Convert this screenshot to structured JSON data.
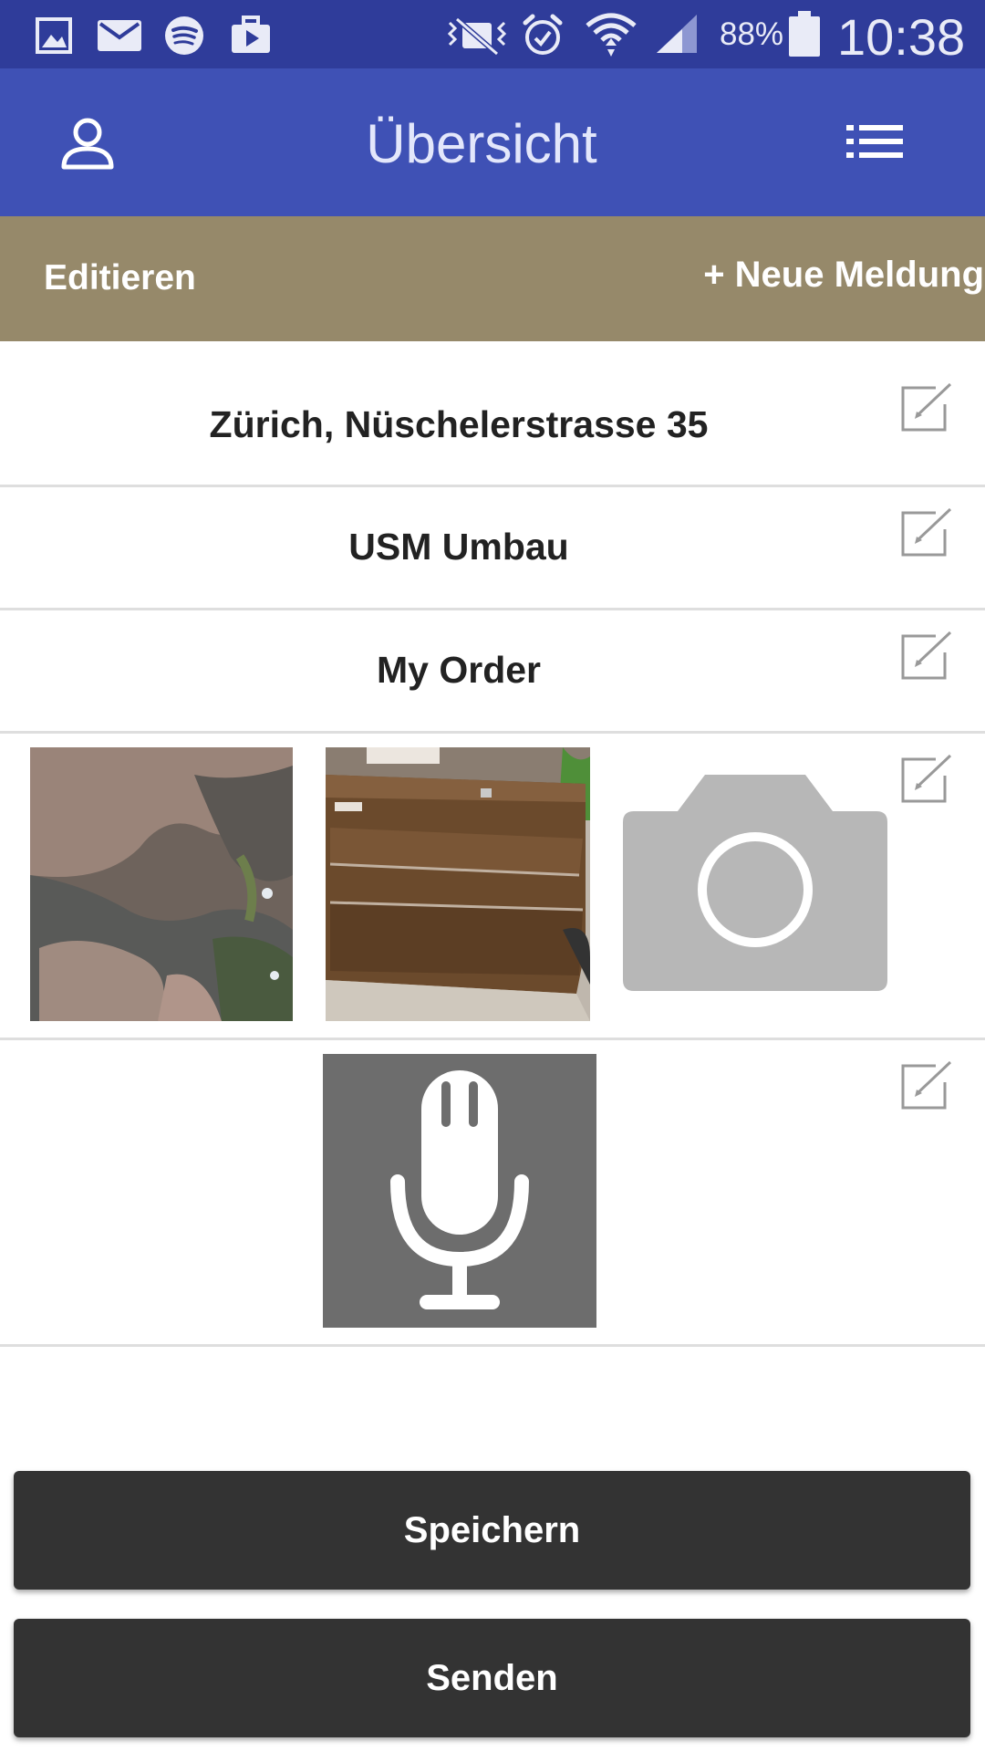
{
  "status_bar": {
    "battery": "88%",
    "time": "10:38",
    "icons": [
      "gallery-icon",
      "mail-icon",
      "spotify-icon",
      "briefcase-icon",
      "mute-icon",
      "alarm-icon",
      "wifi-icon",
      "signal-icon",
      "battery-icon"
    ]
  },
  "app_bar": {
    "title": "Übersicht",
    "icons": [
      "user-icon",
      "list-icon"
    ]
  },
  "action_bar": {
    "edit_label": "Editieren",
    "new_label": "+ Neue Meldung"
  },
  "rows": [
    {
      "label": "Zürich, Nüschelerstrasse 35"
    },
    {
      "label": "USM Umbau"
    },
    {
      "label": "My Order"
    }
  ],
  "media": {
    "photos": [
      "rock-photo",
      "cabinet-photo",
      "camera-placeholder-icon"
    ],
    "audio": "microphone-icon"
  },
  "buttons": {
    "save": "Speichern",
    "send": "Senden"
  },
  "colors": {
    "status_bar": "#2f3c9a",
    "app_bar": "#3f51b5",
    "action_bar": "#96896a",
    "button": "#333333"
  }
}
